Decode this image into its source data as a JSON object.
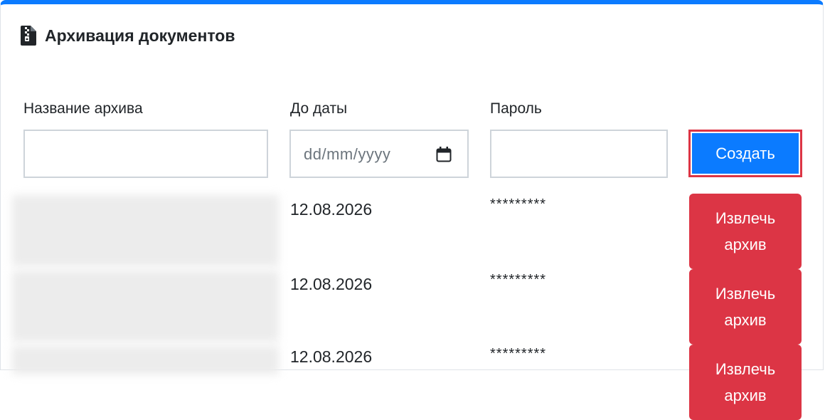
{
  "header": {
    "icon": "file-archive-icon",
    "title": "Архивация документов"
  },
  "form": {
    "name_label": "Название архива",
    "name_value": "",
    "date_label": "До даты",
    "date_placeholder": "dd/mm/yyyy",
    "date_icon": "calendar-icon",
    "password_label": "Пароль",
    "password_value": "",
    "create_label": "Создать"
  },
  "archives": [
    {
      "date": "12.08.2026",
      "password": "*********",
      "action_label": "Извлечь архив"
    },
    {
      "date": "12.08.2026",
      "password": "*********",
      "action_label": "Извлечь архив"
    },
    {
      "date": "12.08.2026",
      "password": "*********",
      "action_label": "Извлечь архив"
    }
  ],
  "colors": {
    "accent": "#0b7bff",
    "danger": "#dc3545",
    "border": "#ced4da"
  }
}
